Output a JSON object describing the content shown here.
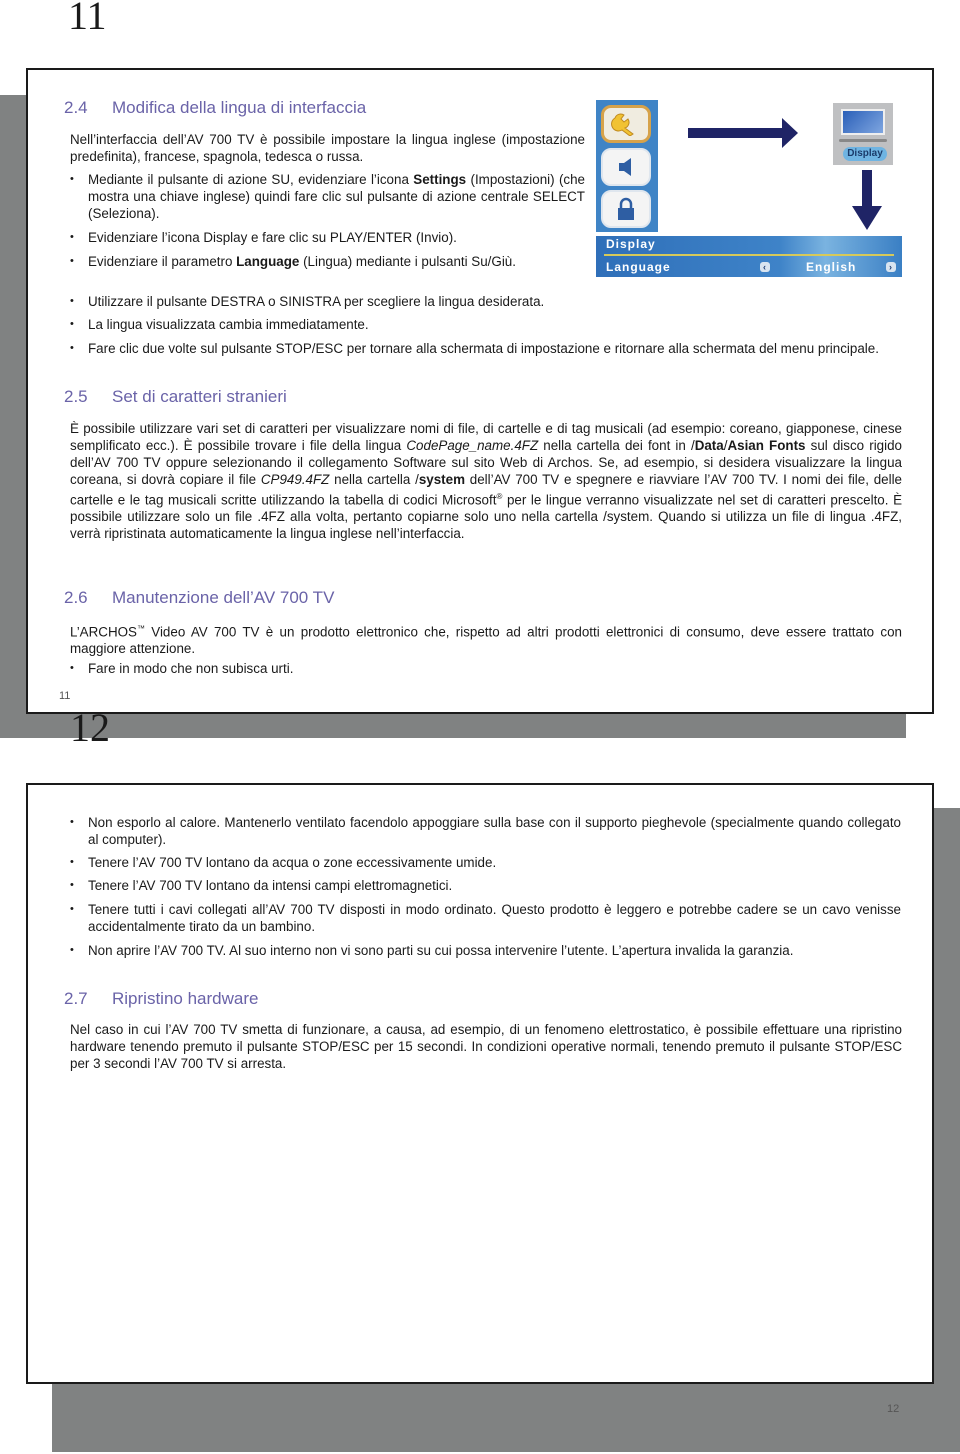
{
  "pages": [
    {
      "big_number": "11",
      "footer_number": "11",
      "sections": {
        "s24": {
          "number": "2.4",
          "title": "Modifica della lingua di interfaccia",
          "intro": "Nell’interfaccia dell’AV 700 TV è possibile impostare la lingua inglese (impostazione predefinita), francese, spagnola, tedesca o russa.",
          "bullets": [
            {
              "pre": "Mediante il pulsante di azione SU, evidenziare l’icona ",
              "bold": "Settings",
              "post": " (Impostazioni) (che mostra una chiave inglese) quindi fare clic sul pulsante di azione centrale SELECT (Seleziona)."
            },
            {
              "text": "Evidenziare l’icona Display e fare clic su PLAY/ENTER (Invio)."
            },
            {
              "pre": "Evidenziare il parametro ",
              "bold": "Language",
              "post": " (Lingua) mediante i pulsanti Su/Giù."
            },
            {
              "text": "Utilizzare il pulsante DESTRA o SINISTRA per scegliere la lingua desiderata."
            },
            {
              "text": "La lingua visualizzata cambia immediatamente."
            },
            {
              "text": "Fare clic due volte sul pulsante STOP/ESC per tornare alla schermata di impostazione e ritornare alla schermata del menu principale."
            }
          ],
          "figure": {
            "icons": [
              "wrench-icon",
              "speaker-icon",
              "lock-icon"
            ],
            "display_label": "Display",
            "menu_title": "Display",
            "menu_param": "Language",
            "menu_value": "English",
            "left_chevron": "‹",
            "right_chevron": "›"
          }
        },
        "s25": {
          "number": "2.5",
          "title": "Set di caratteri stranieri",
          "p1": "È possibile utilizzare vari set di caratteri per visualizzare nomi di file, di cartelle e di tag musicali (ad esempio: coreano, giapponese, cinese semplificato ecc.). È possibile trovare i file della lingua ",
          "p1_italic": "CodePage_name.4FZ",
          "p2": " nella cartella dei font in /",
          "p2_bold1": "Data",
          "p2_slash": "/",
          "p2_bold2": "Asian Fonts",
          "p3": " sul disco rigido dell’AV 700 TV oppure selezionando il collegamento Software sul sito Web di Archos. Se, ad esempio, si desidera visualizzare la lingua coreana, si dovrà copiare il file ",
          "p3_italic": "CP949.4FZ",
          "p4": " nella cartella /",
          "p4_bold": "system",
          "p5": " dell’AV 700 TV e spegnere e riavviare l’AV 700 TV. I nomi dei file, delle cartelle e le tag musicali scritte utilizzando la tabella di codici Microsoft",
          "p5_sup": "®",
          "p6": " per le lingue verranno visualizzate nel set di caratteri prescelto. È possibile utilizzare solo un file .4FZ alla volta, pertanto copiarne solo uno nella cartella /system. Quando si utilizza un file di lingua .4FZ, verrà ripristinata automaticamente la lingua inglese nell’interfaccia."
        },
        "s26": {
          "number": "2.6",
          "title": "Manutenzione dell’AV 700 TV",
          "intro_pre": "L’ARCHOS",
          "intro_tm": "™",
          "intro_post": " Video AV 700 TV è un prodotto elettronico che, rispetto ad altri prodotti elettronici di consumo, deve essere trattato con maggiore attenzione.",
          "bullets": [
            "Fare in modo che non subisca urti."
          ]
        }
      }
    },
    {
      "big_number": "12",
      "footer_number": "12",
      "bullets": [
        "Non esporlo al calore. Mantenerlo ventilato facendolo appoggiare sulla base con il supporto pieghevole (specialmente quando collegato al computer).",
        "Tenere l’AV 700 TV lontano da acqua o zone eccessivamente umide.",
        "Tenere l’AV 700 TV lontano da intensi campi elettromagnetici.",
        "Tenere tutti i cavi collegati all’AV 700 TV disposti in modo ordinato. Questo prodotto è leggero e potrebbe cadere se un cavo venisse accidentalmente tirato da un bambino.",
        "Non aprire l’AV 700 TV. Al suo interno non vi sono parti su cui possa intervenire l’utente. L’apertura invalida la garanzia."
      ],
      "s27": {
        "number": "2.7",
        "title": "Ripristino hardware",
        "text": "Nel caso in cui l’AV 700 TV smetta di funzionare, a causa, ad esempio, di un fenomeno elettrostatico, è possibile effettuare una ripristino hardware tenendo premuto il pulsante STOP/ESC per 15 secondi. In condizioni operative normali, tenendo premuto il pulsante STOP/ESC per 3 secondi l’AV 700 TV si arresta."
      }
    }
  ],
  "colors": {
    "heading": "#6a63a8",
    "shadow": "#808282",
    "menu_blue": "#3e83c8",
    "arrow": "#1f2466"
  }
}
